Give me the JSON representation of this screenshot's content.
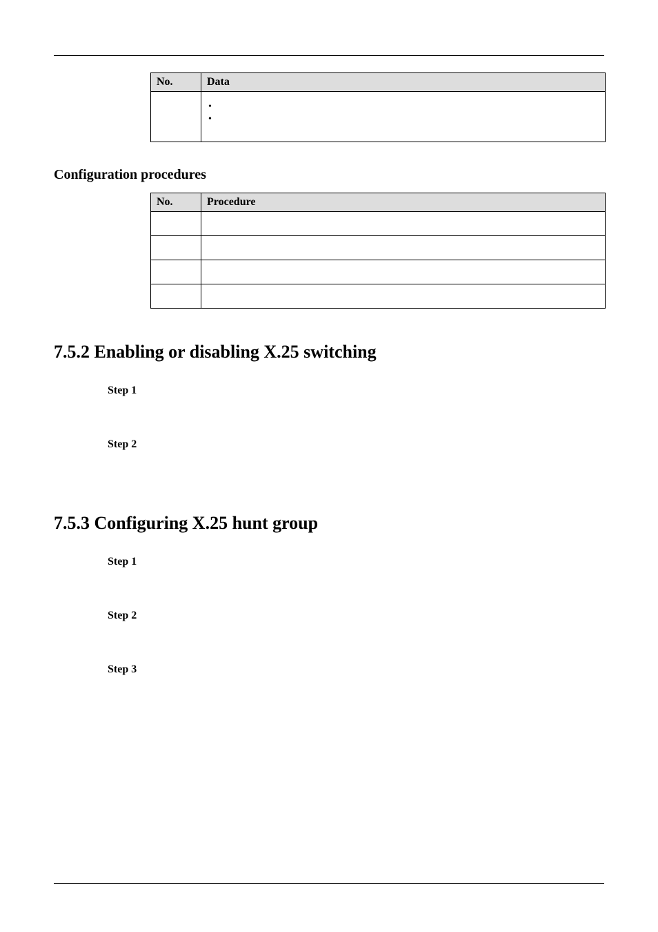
{
  "table1": {
    "headers": {
      "no": "No.",
      "data": "Data"
    },
    "row": {
      "no": "",
      "bullets": [
        "",
        ""
      ]
    }
  },
  "config_heading": "Configuration procedures",
  "table2": {
    "headers": {
      "no": "No.",
      "proc": "Procedure"
    },
    "rows": [
      {
        "no": "",
        "proc": ""
      },
      {
        "no": "",
        "proc": ""
      },
      {
        "no": "",
        "proc": ""
      },
      {
        "no": "",
        "proc": ""
      }
    ]
  },
  "sec_752": "7.5.2 Enabling or disabling X.25 switching",
  "sec_752_steps": [
    "Step 1",
    "Step 2"
  ],
  "sec_753": "7.5.3 Configuring X.25 hunt group",
  "sec_753_steps": [
    "Step 1",
    "Step 2",
    "Step 3"
  ]
}
